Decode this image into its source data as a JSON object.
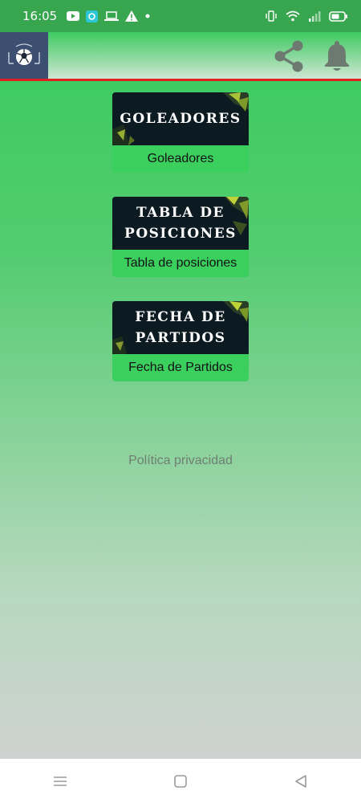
{
  "status_bar": {
    "time": "16:05",
    "left_icons": [
      "youtube-icon",
      "app-notification-icon",
      "laptop-icon",
      "warning-icon",
      "dot-icon"
    ],
    "right_icons": [
      "vibrate-icon",
      "wifi-icon",
      "signal-icon",
      "battery-icon"
    ]
  },
  "app_bar": {
    "logo_icon": "soccer-ball-logo-icon",
    "share_icon": "share-icon",
    "bell_icon": "bell-icon"
  },
  "menu": [
    {
      "banner": "GOLEADORES",
      "label": "Goleadores"
    },
    {
      "banner": "TABLA DE\nPOSICIONES",
      "label": "Tabla de posiciones"
    },
    {
      "banner": "FECHA DE\nPARTIDOS",
      "label": "Fecha de Partidos"
    }
  ],
  "footer": {
    "privacy_label": "Política privacidad"
  },
  "nav_bar": {
    "icons": [
      "menu-icon",
      "home-icon",
      "back-icon"
    ]
  },
  "colors": {
    "status_bar": "#38a64f",
    "accent_green": "#3bcf5e",
    "banner_bg": "#0c1a22",
    "app_bar_border": "#e02020",
    "logo_bg": "#3d4f70",
    "privacy_text": "#6e7f72"
  }
}
